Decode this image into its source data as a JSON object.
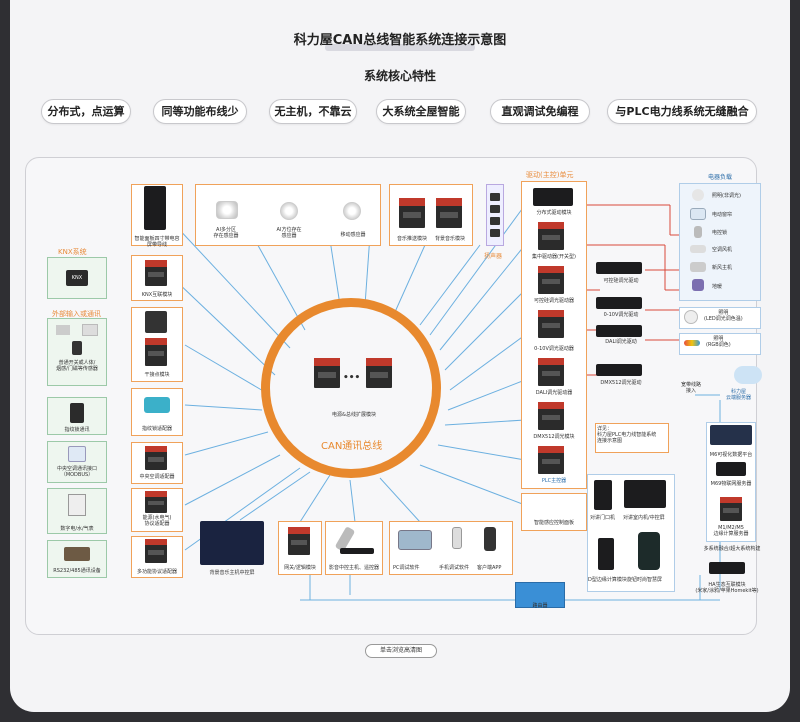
{
  "header": {
    "title": "科力屋CAN总线智能系统连接示意图",
    "subtitle": "系统核心特性"
  },
  "features": [
    "分布式，点运算",
    "同等功能布线少",
    "无主机，不靠云",
    "大系统全屋智能",
    "直观调试免编程",
    "与PLC电力线系统无缝融合"
  ],
  "bus": {
    "center_label": "电源&总线扩展模块",
    "ring_label": "CAN通讯总线"
  },
  "left": {
    "panel_label": "智能面板四寸带电容\n屏带导线",
    "knx_title": "KNX系统",
    "knx_module": "KNX互联模块",
    "external_title": "外部输入或通讯",
    "external_device": "普通开关或人体/\n烟感/门磁等传感器",
    "dry_contact": "干接点模块",
    "fingerprint": "指纹锁通讯",
    "fingerprint_adapter": "指纹锁适配器",
    "ac_device": "中央空调通讯接口\n（MODBUS）",
    "ac_adapter": "中央空调适配器",
    "meter_device": "数字电/水/气表",
    "meter_adapter": "能源(水电气)\n协议适配器",
    "rs_device": "RS232/485通讯设备",
    "rs_adapter": "多功能协议适配器"
  },
  "top": {
    "sensor1": "AI多分区\n存在感应器",
    "sensor2": "AI方位存在\n感应器",
    "sensor3": "移动感应器",
    "music1": "音乐推送模块",
    "music2": "背景音乐模块",
    "speaker": "扬声器"
  },
  "right": {
    "drive_title": "驱动(主控)单元",
    "drive1": "分布式驱动模块",
    "drive2": "集中驱动器(开关型)",
    "drive3": "可控硅调光驱动器",
    "drive4": "0-10V调光驱动器",
    "drive5": "DALI调光驱动器",
    "drive6": "DMX512调光模块",
    "plc": "PLC主控器",
    "mid1": "可控硅调光驱动",
    "mid2": "0-10V调光驱动",
    "mid3": "DALI调光驱动",
    "mid4": "DMX512调光驱动",
    "note": "详见：\n科力屋PLC电力线智能系统\n连接示意图",
    "loads_title": "电器负载",
    "loads": [
      "照明(非调光)",
      "电动窗帘",
      "电控锁",
      "空调风机",
      "新风主机",
      "地暖"
    ],
    "light1": "照明\n(LED调光调色温)",
    "light2": "照明\n(RGB调色)",
    "cloud_in": "宽带线路\n接入",
    "cloud": "科力屋\n云端服务器",
    "gw_label1": "M6可视化数据平台",
    "gw_label2": "M69物联网服务器",
    "gw_label3": "M1/M2/M5\n边缘计算服务器",
    "gw_sub": "多系统融合/超大系统构建",
    "ha": "HA生态互联模块\n(米家/涂鸦/苹果Homekit等)"
  },
  "bottom": {
    "bg_music": "背景音乐主机中控屏",
    "gateway": "网关/逻辑模块",
    "video_host": "影音中控主机、遥控器",
    "pc_software": "PC调试软件",
    "mobile_software": "手机调试软件",
    "customer_app": "客户端APP",
    "intercom1": "对讲门口机",
    "intercom2": "对讲室内机/中控屏",
    "d_panel": "D型边缘计算模块",
    "knob_panel": "旋钮时尚智慧屏",
    "router": "路由器",
    "smart_access": "智能感应控制面板"
  },
  "footer": {
    "zoom_button": "单击浏览高清图"
  },
  "colors": {
    "bus_orange": "#e8892e",
    "box_orange": "#f0a25a",
    "line_blue": "#6cb0e0",
    "line_red": "#d94a3a",
    "knx_green": "#9cc9a8"
  }
}
